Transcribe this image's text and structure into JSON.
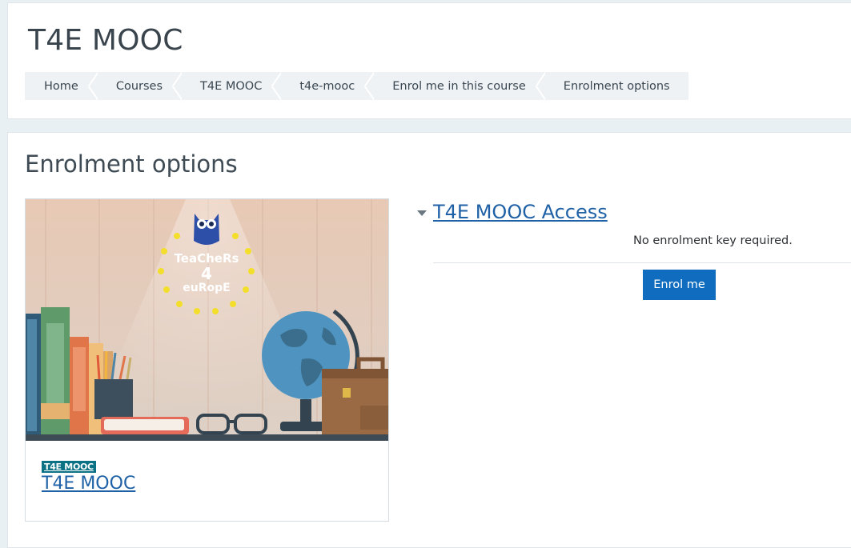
{
  "header": {
    "title": "T4E MOOC",
    "breadcrumb": [
      "Home",
      "Courses",
      "T4E MOOC",
      "t4e-mooc",
      "Enrol me in this course",
      "Enrolment options"
    ]
  },
  "main": {
    "title": "Enrolment options",
    "course": {
      "tag": "T4E MOOC",
      "name": "T4E MOOC",
      "image_text": [
        "TeaCheRs",
        "4",
        "euRopE"
      ]
    },
    "enrol": {
      "method_title": "T4E MOOC Access",
      "note": "No enrolment key required.",
      "button_label": "Enrol me"
    }
  },
  "colors": {
    "link": "#1f61a6",
    "button": "#0f6cbf",
    "tag": "#0b7285"
  }
}
